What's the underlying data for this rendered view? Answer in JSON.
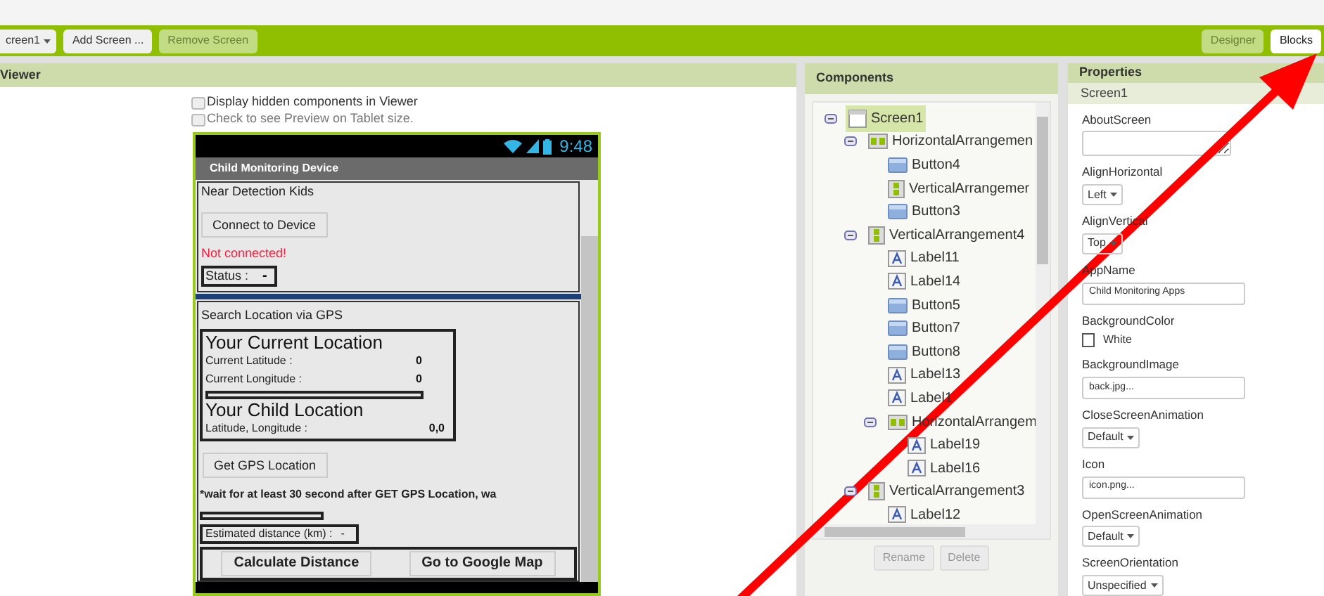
{
  "toolbar": {
    "screen_dropdown": "creen1",
    "buttons": [
      {
        "label": "Add Screen ...",
        "disabled": false
      },
      {
        "label": "Remove Screen",
        "disabled": true
      }
    ],
    "modes": [
      {
        "label": "Designer",
        "selected": true
      },
      {
        "label": "Blocks",
        "selected": false
      }
    ]
  },
  "viewer": {
    "title": "Viewer",
    "options": [
      {
        "label": "Display hidden components in Viewer",
        "checked": false
      },
      {
        "label": "Check to see Preview on Tablet size.",
        "checked": false
      }
    ],
    "phone": {
      "time": "9:48",
      "app_title": "Child Monitoring Device",
      "section1": {
        "heading": "Near Detection Kids",
        "button": "Connect to Device",
        "status_message": "Not connected!",
        "status_label": "Status :",
        "status_value": "-"
      },
      "section2": {
        "heading": "Search Location via GPS",
        "current_title": "Your Current Location",
        "current_rows": [
          {
            "label": "Current Latitude :",
            "value": "0"
          },
          {
            "label": "Current Longitude :",
            "value": "0"
          }
        ],
        "child_title": "Your Child Location",
        "child_row": {
          "label": "Latitude, Longitude :",
          "value": "0,0"
        },
        "gps_button": "Get GPS Location",
        "note": "*wait for at least 30 second after GET GPS Location, wa",
        "distance_label": "Estimated distance (km) :",
        "distance_value": "-",
        "action_buttons": [
          "Calculate Distance",
          "Go to Google Map"
        ]
      }
    }
  },
  "components": {
    "title": "Components",
    "tree": [
      {
        "name": "Screen1",
        "kind": "screen",
        "selected": true,
        "expanded": true,
        "children": [
          {
            "name": "HorizontalArrangemen",
            "kind": "horizontal",
            "selected": false,
            "expanded": true,
            "children": [
              {
                "name": "Button4",
                "kind": "button",
                "selected": false
              },
              {
                "name": "VerticalArrangemer",
                "kind": "vertical",
                "selected": false
              },
              {
                "name": "Button3",
                "kind": "button",
                "selected": false
              }
            ]
          },
          {
            "name": "VerticalArrangement4",
            "kind": "vertical",
            "selected": false,
            "expanded": true,
            "children": [
              {
                "name": "Label11",
                "kind": "label",
                "selected": false
              },
              {
                "name": "Label14",
                "kind": "label",
                "selected": false
              },
              {
                "name": "Button5",
                "kind": "button",
                "selected": false
              },
              {
                "name": "Button7",
                "kind": "button",
                "selected": false
              },
              {
                "name": "Button8",
                "kind": "button",
                "selected": false
              },
              {
                "name": "Label13",
                "kind": "label",
                "selected": false
              },
              {
                "name": "Label1",
                "kind": "label",
                "selected": false
              },
              {
                "name": "HorizontalArrangem",
                "kind": "horizontal",
                "selected": false,
                "expanded": true,
                "children": [
                  {
                    "name": "Label19",
                    "kind": "label",
                    "selected": false
                  },
                  {
                    "name": "Label16",
                    "kind": "label",
                    "selected": false
                  }
                ]
              }
            ]
          },
          {
            "name": "VerticalArrangement3",
            "kind": "vertical",
            "selected": false,
            "expanded": true,
            "children": [
              {
                "name": "Label12",
                "kind": "label",
                "selected": false
              }
            ]
          }
        ]
      }
    ],
    "buttons": [
      {
        "label": "Rename",
        "disabled": true
      },
      {
        "label": "Delete",
        "disabled": true
      }
    ]
  },
  "properties": {
    "title": "Properties",
    "component": "Screen1",
    "items": [
      {
        "name": "AboutScreen",
        "kind": "textarea"
      },
      {
        "name": "AlignHorizontal",
        "kind": "dropdown",
        "value": "Left"
      },
      {
        "name": "AlignVertical",
        "kind": "dropdown",
        "value": "Top"
      },
      {
        "name": "AppName",
        "kind": "text",
        "value": "Child Monitoring Apps"
      },
      {
        "name": "BackgroundColor",
        "kind": "color",
        "value": "White",
        "color": "#ffffff"
      },
      {
        "name": "BackgroundImage",
        "kind": "text",
        "value": "back.jpg..."
      },
      {
        "name": "CloseScreenAnimation",
        "kind": "dropdown",
        "value": "Default"
      },
      {
        "name": "Icon",
        "kind": "text",
        "value": "icon.png..."
      },
      {
        "name": "OpenScreenAnimation",
        "kind": "dropdown",
        "value": "Default"
      },
      {
        "name": "ScreenOrientation",
        "kind": "dropdown",
        "value": "Unspecified"
      }
    ]
  }
}
